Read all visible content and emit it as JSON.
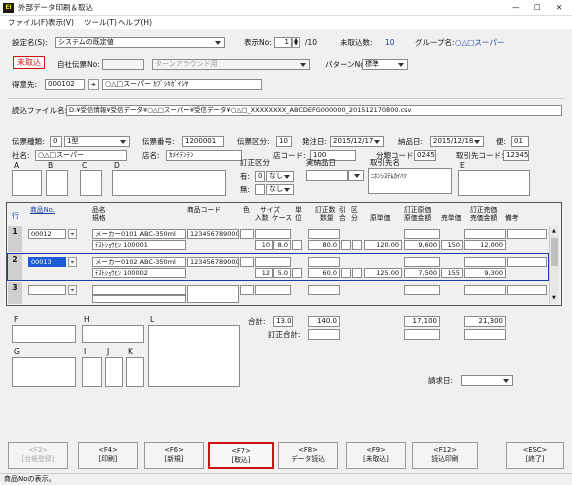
{
  "window": {
    "title": "外部データ印刷＆取込",
    "icon": "EI",
    "min": "—",
    "max": "☐",
    "close": "✕"
  },
  "menu": [
    "ファイル(F)",
    "表示(V)",
    "ツール(T)",
    "ヘルプ(H)"
  ],
  "top": {
    "settings_label": "設定名(S):",
    "settings_value": "システムの既定値",
    "display_label": "表示No:",
    "display_value": "1",
    "display_total": "/10",
    "unimported_label": "未取込数:",
    "unimported_value": "10",
    "group_label": "グループ名:",
    "group_value": "○△□スーパー"
  },
  "status_badge": "未取込",
  "slip": {
    "label": "自社伝票No:",
    "value": "",
    "turnaround": "ターンアラウンド用"
  },
  "pattern": {
    "label": "パターンNo:",
    "value": "標準"
  },
  "customer": {
    "label": "得意先:",
    "code": "000102",
    "name": "○△□スーパー ｶﾌﾞｼｷｶﾞｲｼﾔ"
  },
  "file": {
    "label": "読込ファイル名:",
    "value": "D:¥受信情報¥受信データ¥○△□スーパー¥受信データ¥○△□_XXXXXXXX_ABCDEFG000000_201512170800.csv"
  },
  "header": {
    "slip_type_label": "伝票種類:",
    "slip_type_code": "0",
    "slip_type_value": "1型",
    "slip_no_label": "伝票番号:",
    "slip_no_value": "1200001",
    "slip_class_label": "伝票区分:",
    "slip_class_value": "10",
    "order_date_label": "発注日:",
    "order_date_value": "2015/12/17",
    "delivery_date_label": "納品日:",
    "delivery_date_value": "2015/12/18",
    "flight_label": "便:",
    "flight_value": "01",
    "company_label": "社名:",
    "company_value": "○△□スーパー",
    "store_label": "店名:",
    "store_value": "ｶﾒｲﾃﾝﾃﾝ",
    "store_code_label": "店コード:",
    "store_code_value": "100",
    "class_code_label": "分類コード:",
    "class_code_value": "0245",
    "trade_code_label": "取引先コード:",
    "trade_code_value": "12345",
    "a": "A",
    "b": "B",
    "c": "C",
    "d": "D",
    "e": "E",
    "correction_label": "訂正区分",
    "yes_label": "有:",
    "yes_code": "0",
    "yes_value": "なし",
    "no_label": "無:",
    "no_value": "なし",
    "deliv_label": "実納品日",
    "trade_name_label": "取引先名",
    "trade_name_value": "ﾆﾎﾝｼｽﾃﾑｶｲﾊﾂ"
  },
  "columns": {
    "row": "行",
    "product_no": "商品No.",
    "name": "品名",
    "spec": "規格",
    "code": "商品コード",
    "color": "色",
    "size": "サイズ",
    "qty_in": "入数",
    "case": "ケース",
    "unit": "単位",
    "corr_qty": "訂正数",
    "qty": "数量",
    "discount": "引合",
    "class": "区分",
    "cost": "原単価",
    "corr_cost": "訂正原価",
    "cost_total": "原価金額",
    "sell": "売単価",
    "corr_sell": "訂正売価",
    "sell_total": "売価金額",
    "note": "備考"
  },
  "rows": [
    {
      "no": "1",
      "product_no": "00012",
      "name": "メーカー0101 ABC-350ml",
      "spec": "ﾃｽﾄｼｮｳﾋﾝ 100001",
      "code": "1234567890001",
      "qty_in": "10",
      "case": "8.0",
      "qty": "80.0",
      "cost": "120.00",
      "cost_total": "9,600",
      "sell": "150",
      "sell_total": "12,000"
    },
    {
      "no": "2",
      "product_no": "00013",
      "name": "メーカー0102 ABC-350ml",
      "spec": "ﾃｽﾄｼｮｳﾋﾝ 100002",
      "code": "1234567890002",
      "qty_in": "12",
      "case": "5.0",
      "qty": "60.0",
      "cost": "125.00",
      "cost_total": "7,500",
      "sell": "155",
      "sell_total": "9,300"
    },
    {
      "no": "3",
      "product_no": "",
      "name": "",
      "spec": "",
      "code": "",
      "qty_in": "",
      "case": "",
      "qty": "",
      "cost": "",
      "cost_total": "",
      "sell": "",
      "sell_total": ""
    }
  ],
  "footer": {
    "f": "F",
    "h": "H",
    "l": "L",
    "g": "G",
    "i": "I",
    "j": "J",
    "k": "K",
    "total_label": "合計:",
    "total_case": "13.0",
    "total_qty": "140.0",
    "total_cost": "17,100",
    "total_sell": "21,300",
    "corr_total_label": "訂正合計:",
    "billing_label": "請求日:"
  },
  "fkeys": [
    {
      "key": "<F3>",
      "label": "[台帳登録]"
    },
    {
      "key": "<F4>",
      "label": "[印刷]"
    },
    {
      "key": "<F6>",
      "label": "[新規]"
    },
    {
      "key": "<F7>",
      "label": "[取込]"
    },
    {
      "key": "<F8>",
      "label": "データ読込"
    },
    {
      "key": "<F9>",
      "label": "[未取込]"
    },
    {
      "key": "<F12>",
      "label": "読込印刷"
    },
    {
      "key": "<ESC>",
      "label": "[終了]"
    }
  ],
  "statusbar": "商品Noの表示。",
  "colors": {
    "accent": "#1a3ea8",
    "red": "#d01010",
    "selection": "#1e5ad6"
  }
}
